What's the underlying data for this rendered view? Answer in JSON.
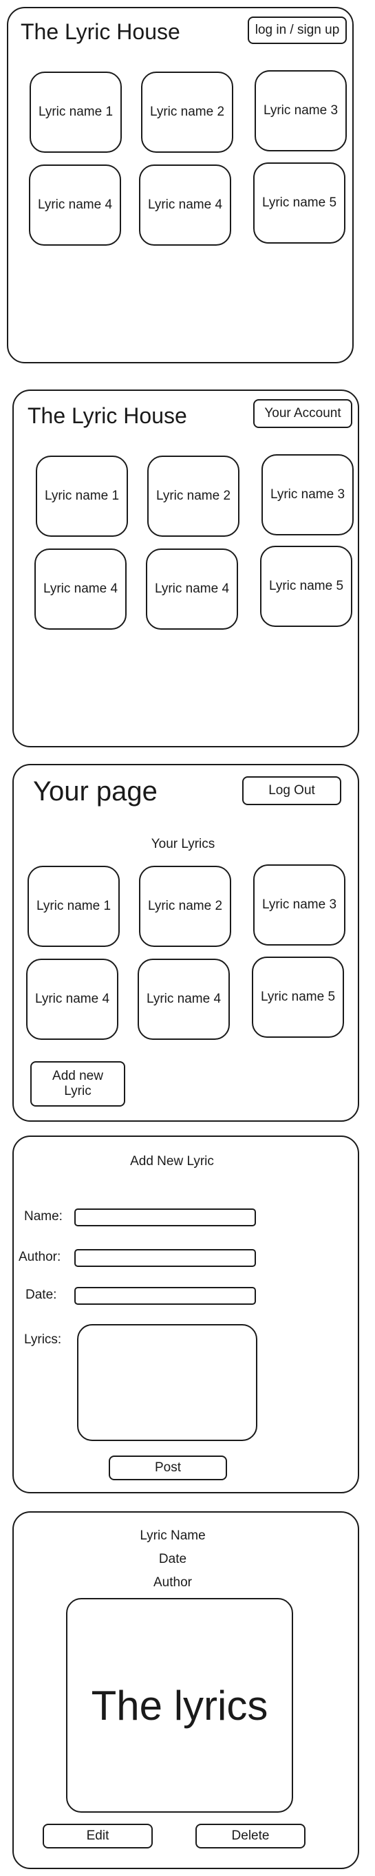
{
  "screen1": {
    "title": "The Lyric House",
    "login_button": "log in / sign up",
    "lyrics": [
      "Lyric name 1",
      "Lyric name 2",
      "Lyric name 3",
      "Lyric name 4",
      "Lyric name 4",
      "Lyric name 5"
    ]
  },
  "screen2": {
    "title": "The Lyric House",
    "account_button": "Your Account",
    "lyrics": [
      "Lyric name 1",
      "Lyric name 2",
      "Lyric name 3",
      "Lyric name 4",
      "Lyric name 4",
      "Lyric name 5"
    ]
  },
  "screen3": {
    "title": "Your page",
    "logout_button": "Log Out",
    "section_label": "Your Lyrics",
    "lyrics": [
      "Lyric name 1",
      "Lyric name 2",
      "Lyric name 3",
      "Lyric name 4",
      "Lyric name 4",
      "Lyric name 5"
    ],
    "add_button": "Add new Lyric"
  },
  "screen4": {
    "title": "Add New Lyric",
    "name_label": "Name:",
    "author_label": "Author:",
    "date_label": "Date:",
    "lyrics_label": "Lyrics:",
    "post_button": "Post"
  },
  "screen5": {
    "lyric_name": "Lyric Name",
    "date": "Date",
    "author": "Author",
    "lyrics_text": "The lyrics",
    "edit_button": "Edit",
    "delete_button": "Delete"
  }
}
